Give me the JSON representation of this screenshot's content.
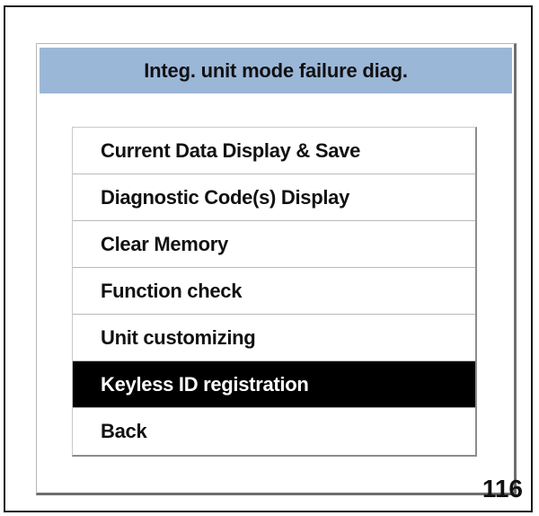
{
  "dialog": {
    "title": "Integ. unit mode failure diag."
  },
  "menu": {
    "items": [
      {
        "label": "Current Data Display & Save",
        "selected": false
      },
      {
        "label": "Diagnostic Code(s) Display",
        "selected": false
      },
      {
        "label": "Clear Memory",
        "selected": false
      },
      {
        "label": "Function check",
        "selected": false
      },
      {
        "label": "Unit customizing",
        "selected": false
      },
      {
        "label": "Keyless ID registration",
        "selected": true
      },
      {
        "label": "Back",
        "selected": false
      }
    ]
  },
  "figure": {
    "number": "116"
  },
  "colors": {
    "title_bar": "#9bb7d8",
    "selected_bg": "#000000",
    "selected_text": "#ffffff"
  }
}
